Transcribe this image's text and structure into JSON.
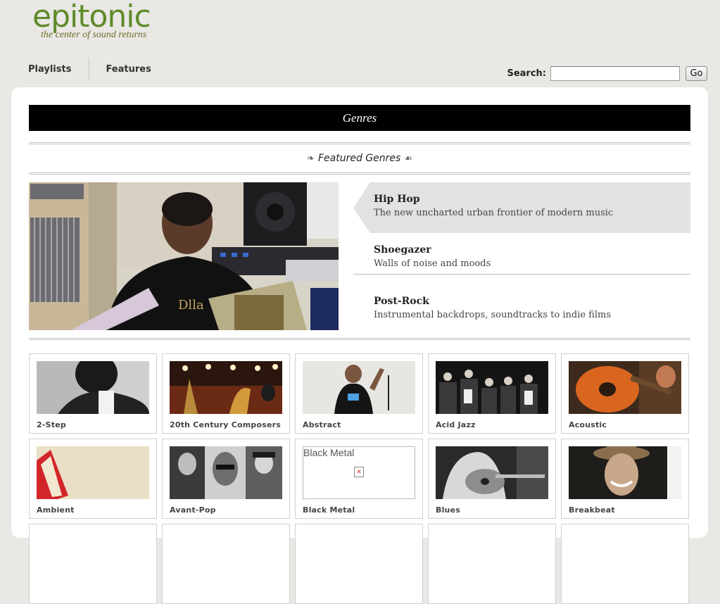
{
  "header": {
    "logo_word": "epitonic",
    "tagline": "the center of sound returns"
  },
  "nav": {
    "items": [
      {
        "label": "Playlists"
      },
      {
        "label": "Features"
      }
    ]
  },
  "search": {
    "label": "Search:",
    "value": "",
    "button_label": "Go"
  },
  "main": {
    "section_title": "Genres",
    "featured_heading": "Featured Genres",
    "featured_ornament_left": "❧",
    "featured_ornament_right": "☙",
    "featured": [
      {
        "title": "Hip Hop",
        "desc": "The new uncharted urban frontier of modern music",
        "active": true
      },
      {
        "title": "Shoegazer",
        "desc": "Walls of noise and moods",
        "active": false
      },
      {
        "title": "Post-Rock",
        "desc": "Instrumental backdrops, soundtracks to indie films",
        "active": false
      }
    ],
    "genres": [
      {
        "label": "2-Step"
      },
      {
        "label": "20th Century Composers"
      },
      {
        "label": "Abstract"
      },
      {
        "label": "Acid Jazz"
      },
      {
        "label": "Acoustic"
      },
      {
        "label": "Ambient"
      },
      {
        "label": "Avant-Pop"
      },
      {
        "label": "Black Metal",
        "broken_image_alt": "Black Metal"
      },
      {
        "label": "Blues"
      },
      {
        "label": "Breakbeat"
      }
    ]
  },
  "colors": {
    "page_bg": "#e9e8e4",
    "logo_green": "#5f8a2a",
    "tagline_olive": "#6b6d2b",
    "genres_bar_bg": "#000000",
    "active_feature_bg": "#e2e2e2"
  }
}
